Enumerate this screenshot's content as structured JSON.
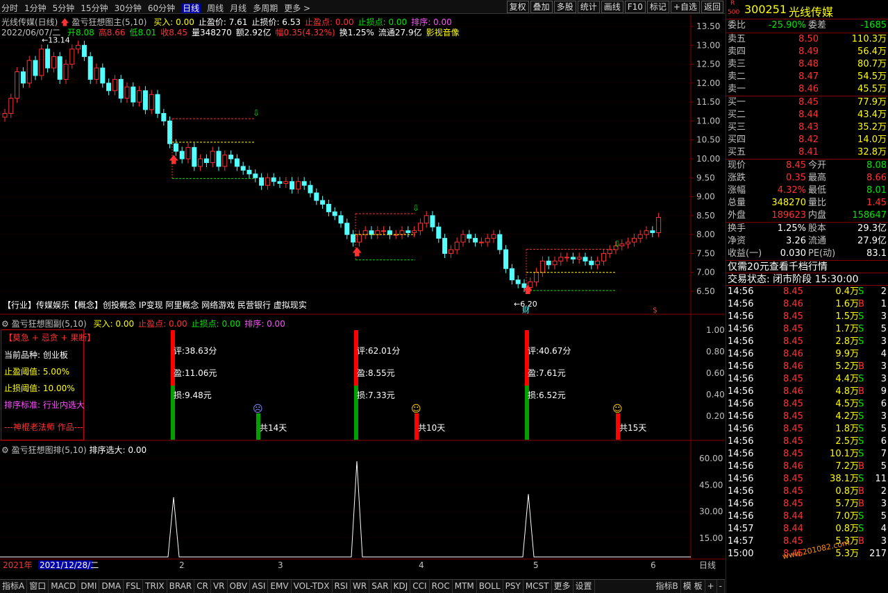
{
  "periods": [
    "分时",
    "1分钟",
    "5分钟",
    "15分钟",
    "30分钟",
    "60分钟",
    "日线",
    "周线",
    "月线",
    "多周期",
    "更多 >"
  ],
  "active_period": "日线",
  "tools": [
    "复权",
    "叠加",
    "多股",
    "统计",
    "画线",
    "F10",
    "标记",
    "+自选",
    "返回"
  ],
  "main": {
    "title_prefix": "光线传媒(日线)",
    "indicator": "盈亏狂想图主(5,10)",
    "ind_values": [
      {
        "t": "买入: 0.00",
        "c": "yellow"
      },
      {
        "t": "止盈价: 7.61",
        "c": "white"
      },
      {
        "t": "止损价: 6.53",
        "c": "white"
      },
      {
        "t": "止盈点: 0.00",
        "c": "red"
      },
      {
        "t": "止损点: 0.00",
        "c": "green"
      },
      {
        "t": "排序: 0.00",
        "c": "magenta"
      }
    ],
    "date": "2022/06/07/二",
    "quote": [
      {
        "t": "开8.08",
        "c": "green"
      },
      {
        "t": "高8.66",
        "c": "red"
      },
      {
        "t": "低8.01",
        "c": "green"
      },
      {
        "t": "收8.45",
        "c": "red"
      },
      {
        "t": "量348270",
        "c": "white"
      },
      {
        "t": "额2.92亿",
        "c": "white"
      },
      {
        "t": "幅0.35(4.32%)",
        "c": "red"
      },
      {
        "t": "换1.25%",
        "c": "white"
      },
      {
        "t": "流通27.9亿",
        "c": "white"
      },
      {
        "t": "影视音像",
        "c": "yellow"
      }
    ],
    "concepts": "【行业】传媒娱乐【概念】创投概念 IP变现 阿里概念 网络游戏 民营银行 虚拟现实",
    "high_label": "13.14",
    "low_label": "6.20",
    "cai_label": "财",
    "s_label": "$",
    "yticks": [
      "13.50",
      "13.00",
      "12.50",
      "12.00",
      "11.50",
      "11.00",
      "10.50",
      "10.00",
      "9.50",
      "9.00",
      "8.50",
      "8.00",
      "7.50",
      "7.00",
      "6.50"
    ]
  },
  "sub1": {
    "title": "盈亏狂想图副(5,10)",
    "values": [
      {
        "t": "买入: 0.00",
        "c": "yellow"
      },
      {
        "t": "止盈点: 0.00",
        "c": "red"
      },
      {
        "t": "止损点: 0.00",
        "c": "green"
      },
      {
        "t": "排序: 0.00",
        "c": "magenta"
      }
    ],
    "yticks": [
      "1.00",
      "0.80",
      "0.60",
      "0.40",
      "0.20"
    ],
    "box": {
      "title": "【莫急 + 忌贪 + 果断】",
      "kind": "当前品种: 创业板",
      "tp": "止盈阈值: 5.00%",
      "sl": "止损阈值: 10.00%",
      "sort": "排序标准: 行业内选大",
      "author": "---神棍老法师 作品---"
    },
    "signals": [
      {
        "score": "评:38.63分",
        "profit": "盈:11.06元",
        "loss": "损:9.48元",
        "days": "共14天",
        "face": "sad"
      },
      {
        "score": "评:62.01分",
        "profit": "盈:8.55元",
        "loss": "损:7.33元",
        "days": "共10天",
        "face": "happy"
      },
      {
        "score": "评:40.67分",
        "profit": "盈:7.61元",
        "loss": "损:6.52元",
        "days": "共15天",
        "face": "happy"
      }
    ]
  },
  "sub2": {
    "title": "盈亏狂想图排(5,10)",
    "value": "排序选大: 0.00",
    "yticks": [
      "60.00",
      "45.00",
      "30.00",
      "15.00"
    ]
  },
  "xaxis": {
    "year": "2021年",
    "date": "2021/12/28/二",
    "months": [
      "2",
      "3",
      "4",
      "5",
      "6"
    ],
    "period": "日线"
  },
  "bottom_tabs": [
    "指标A",
    "窗口",
    "MACD",
    "DMI",
    "DMA",
    "FSL",
    "TRIX",
    "BRAR",
    "CR",
    "VR",
    "OBV",
    "ASI",
    "EMV",
    "VOL-TDX",
    "RSI",
    "WR",
    "SAR",
    "KDJ",
    "CCI",
    "ROC",
    "MTM",
    "BOLL",
    "PSY",
    "MCST",
    "更多",
    "设置"
  ],
  "bottom_right": [
    "指标B",
    "模 板",
    "+",
    "-"
  ],
  "stock": {
    "code": "300251",
    "name": "光线传媒",
    "badge_r": "R",
    "badge_n": "500"
  },
  "weibi": {
    "label": "委比",
    "value": "-25.90%",
    "label2": "委差",
    "value2": "-1685"
  },
  "asks": [
    {
      "l": "卖五",
      "p": "8.50",
      "v": "110.3万"
    },
    {
      "l": "卖四",
      "p": "8.49",
      "v": "56.4万"
    },
    {
      "l": "卖三",
      "p": "8.48",
      "v": "80.7万"
    },
    {
      "l": "卖二",
      "p": "8.47",
      "v": "54.5万"
    },
    {
      "l": "卖一",
      "p": "8.46",
      "v": "45.5万"
    }
  ],
  "bids": [
    {
      "l": "买一",
      "p": "8.45",
      "v": "77.9万"
    },
    {
      "l": "买二",
      "p": "8.44",
      "v": "43.4万"
    },
    {
      "l": "买三",
      "p": "8.43",
      "v": "35.2万"
    },
    {
      "l": "买四",
      "p": "8.42",
      "v": "14.0万"
    },
    {
      "l": "买五",
      "p": "8.41",
      "v": "32.8万"
    }
  ],
  "stats": [
    {
      "a": "现价",
      "av": "8.45",
      "ac": "red",
      "b": "今开",
      "bv": "8.08",
      "bc": "green"
    },
    {
      "a": "涨跌",
      "av": "0.35",
      "ac": "red",
      "b": "最高",
      "bv": "8.66",
      "bc": "red"
    },
    {
      "a": "涨幅",
      "av": "4.32%",
      "ac": "red",
      "b": "最低",
      "bv": "8.01",
      "bc": "green"
    },
    {
      "a": "总量",
      "av": "348270",
      "ac": "yellow",
      "b": "量比",
      "bv": "1.45",
      "bc": "red"
    },
    {
      "a": "外盘",
      "av": "189623",
      "ac": "red",
      "b": "内盘",
      "bv": "158647",
      "bc": "green"
    }
  ],
  "stats2": [
    {
      "a": "换手",
      "av": "1.25%",
      "b": "股本",
      "bv": "29.3亿"
    },
    {
      "a": "净资",
      "av": "3.26",
      "b": "流通",
      "bv": "27.9亿"
    },
    {
      "a": "收益(一)",
      "av": "0.030",
      "b": "PE(动)",
      "bv": "83.1"
    }
  ],
  "promo": "仅需20元查看千档行情",
  "trade_status": "交易状态: 闭市阶段 15:30:00",
  "ticks": [
    {
      "t": "14:56",
      "p": "8.45",
      "pc": "red",
      "v": "0.4万",
      "bs": "S",
      "n": "2"
    },
    {
      "t": "14:56",
      "p": "8.46",
      "pc": "red",
      "v": "1.6万",
      "bs": "B",
      "n": "1"
    },
    {
      "t": "14:56",
      "p": "8.45",
      "pc": "red",
      "v": "1.5万",
      "bs": "S",
      "n": "3"
    },
    {
      "t": "14:56",
      "p": "8.45",
      "pc": "red",
      "v": "1.7万",
      "bs": "S",
      "n": "5"
    },
    {
      "t": "14:56",
      "p": "8.45",
      "pc": "red",
      "v": "2.8万",
      "bs": "S",
      "n": "3"
    },
    {
      "t": "14:56",
      "p": "8.46",
      "pc": "red",
      "v": "9.9万",
      "bs": "",
      "n": "4"
    },
    {
      "t": "14:56",
      "p": "8.46",
      "pc": "red",
      "v": "5.2万",
      "bs": "B",
      "n": "3"
    },
    {
      "t": "14:56",
      "p": "8.45",
      "pc": "red",
      "v": "4.4万",
      "bs": "S",
      "n": "3"
    },
    {
      "t": "14:56",
      "p": "8.46",
      "pc": "red",
      "v": "4.8万",
      "bs": "B",
      "n": "9"
    },
    {
      "t": "14:56",
      "p": "8.45",
      "pc": "red",
      "v": "4.5万",
      "bs": "S",
      "n": "6"
    },
    {
      "t": "14:56",
      "p": "8.45",
      "pc": "red",
      "v": "4.2万",
      "bs": "S",
      "n": "3"
    },
    {
      "t": "14:56",
      "p": "8.45",
      "pc": "red",
      "v": "1.8万",
      "bs": "S",
      "n": "5"
    },
    {
      "t": "14:56",
      "p": "8.45",
      "pc": "red",
      "v": "2.5万",
      "bs": "S",
      "n": "6"
    },
    {
      "t": "14:56",
      "p": "8.45",
      "pc": "red",
      "v": "10.1万",
      "bs": "S",
      "n": "7"
    },
    {
      "t": "14:56",
      "p": "8.46",
      "pc": "red",
      "v": "7.2万",
      "bs": "B",
      "n": "5"
    },
    {
      "t": "14:56",
      "p": "8.45",
      "pc": "red",
      "v": "38.1万",
      "bs": "S",
      "n": "11"
    },
    {
      "t": "14:56",
      "p": "8.45",
      "pc": "red",
      "v": "0.8万",
      "bs": "B",
      "n": "2"
    },
    {
      "t": "14:56",
      "p": "8.45",
      "pc": "red",
      "v": "5.7万",
      "bs": "B",
      "n": "3"
    },
    {
      "t": "14:56",
      "p": "8.44",
      "pc": "red",
      "v": "7.0万",
      "bs": "S",
      "n": "5"
    },
    {
      "t": "14:57",
      "p": "8.44",
      "pc": "red",
      "v": "0.8万",
      "bs": "S",
      "n": "4"
    },
    {
      "t": "14:57",
      "p": "8.45",
      "pc": "red",
      "v": "5.3万",
      "bs": "B",
      "n": "3"
    },
    {
      "t": "15:00",
      "p": "8.45",
      "pc": "red",
      "v": "5.3万",
      "bs": "",
      "n": "217"
    }
  ],
  "watermark": "www.201082.com",
  "colors": {
    "up": "#ff3232",
    "down": "#54ffff",
    "frame": "#8a0000",
    "bg": "#000000"
  }
}
